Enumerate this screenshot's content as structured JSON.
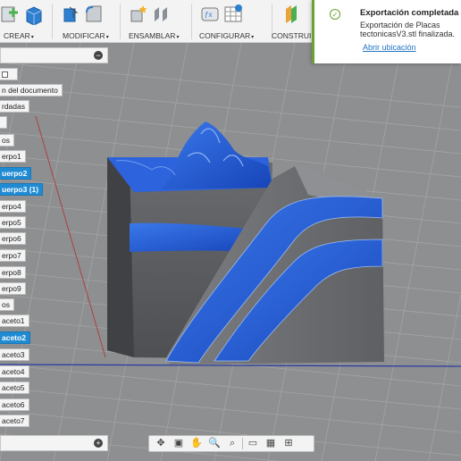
{
  "toolbar": {
    "groups": [
      {
        "label": "CREAR"
      },
      {
        "label": "MODIFICAR"
      },
      {
        "label": "ENSAMBLAR"
      },
      {
        "label": "CONFIGURAR"
      },
      {
        "label": "CONSTRUIR"
      }
    ],
    "caret": "▾"
  },
  "browser": {
    "items": [
      {
        "label": "n del documento",
        "selected": false
      },
      {
        "label": "rdadas",
        "selected": false
      },
      {
        "label": "",
        "selected": false
      },
      {
        "label": "os",
        "selected": false
      },
      {
        "label": "erpo1",
        "selected": false
      },
      {
        "label": "uerpo2",
        "selected": true
      },
      {
        "label": "uerpo3 (1)",
        "selected": true
      },
      {
        "label": "erpo4",
        "selected": false
      },
      {
        "label": "erpo5",
        "selected": false
      },
      {
        "label": "erpo6",
        "selected": false
      },
      {
        "label": "erpo7",
        "selected": false
      },
      {
        "label": "erpo8",
        "selected": false
      },
      {
        "label": "erpo9",
        "selected": false
      },
      {
        "label": "os",
        "selected": false
      },
      {
        "label": "aceto1",
        "selected": false
      },
      {
        "label": "aceto2",
        "selected": true
      },
      {
        "label": "aceto3",
        "selected": false
      },
      {
        "label": "aceto4",
        "selected": false
      },
      {
        "label": "aceto5",
        "selected": false
      },
      {
        "label": "aceto6",
        "selected": false
      },
      {
        "label": "aceto7",
        "selected": false
      }
    ]
  },
  "notification": {
    "title": "Exportación completada",
    "message": "Exportación de Placas tectonicasV3.stl finalizada.",
    "link": "Abrir ubicación",
    "status_color": "#6aa22f"
  },
  "colors": {
    "model_blue": "#1f5bd6",
    "model_gray": "#5d5f62",
    "selection": "#1f8bd3",
    "viewport_bg": "#8d8f91"
  }
}
